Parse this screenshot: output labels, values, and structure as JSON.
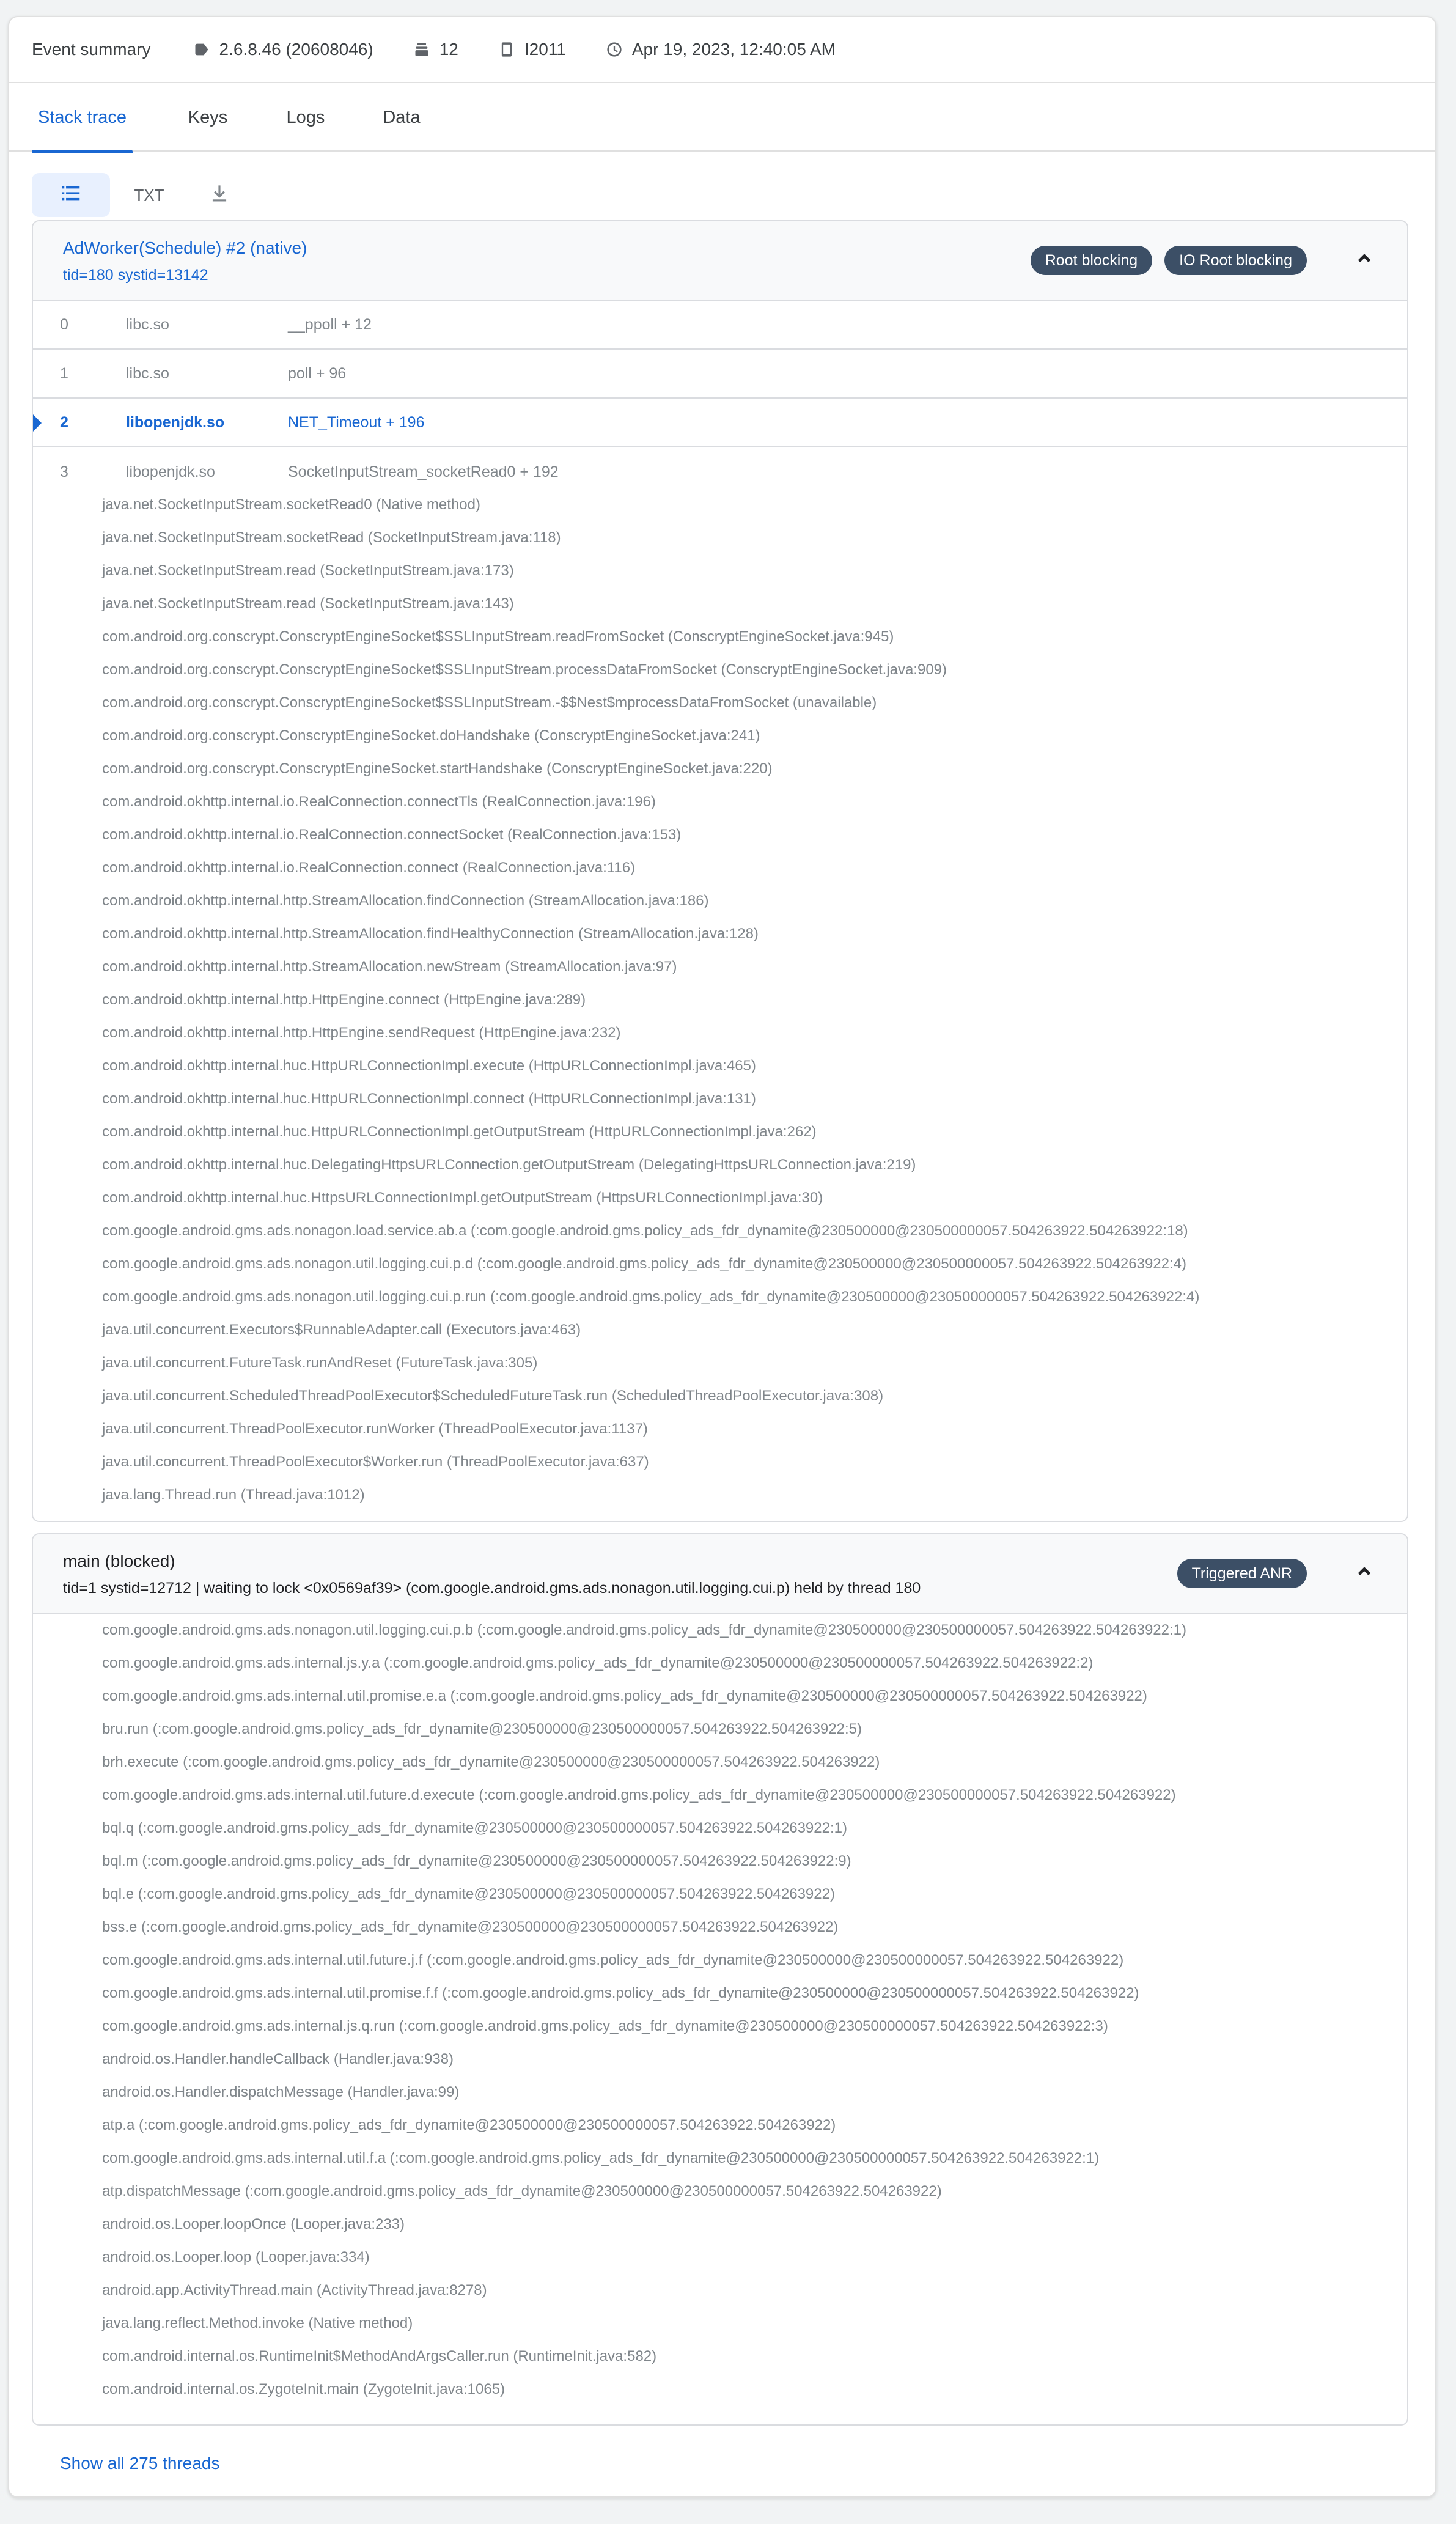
{
  "summary": {
    "label": "Event summary",
    "version": "2.6.8.46 (20608046)",
    "version_icon": "tag-icon",
    "devices": "12",
    "devices_icon": "stack-icon",
    "device_model": "I2011",
    "device_icon": "phone-icon",
    "timestamp": "Apr 19, 2023, 12:40:05 AM",
    "time_icon": "clock-icon"
  },
  "tabs": [
    "Stack trace",
    "Keys",
    "Logs",
    "Data"
  ],
  "active_tab": "Stack trace",
  "toolbar": {
    "list_icon": "list-icon",
    "txt_label": "TXT",
    "download_icon": "download-icon"
  },
  "colors": {
    "accent": "#1967d2",
    "badge_bg": "#3c4f66",
    "selected_bg": "#e8f0fe",
    "muted_text": "#80868b"
  },
  "thread1": {
    "name": "AdWorker(Schedule) #2 (native)",
    "sub": "tid=180 systid=13142",
    "badges": [
      "Root blocking",
      "IO Root blocking"
    ],
    "frames": [
      {
        "idx": "0",
        "lib": "libc.so",
        "sym": "__ppoll + 12"
      },
      {
        "idx": "1",
        "lib": "libc.so",
        "sym": "poll + 96"
      },
      {
        "idx": "2",
        "lib": "libopenjdk.so",
        "sym": "NET_Timeout + 196"
      },
      {
        "idx": "3",
        "lib": "libopenjdk.so",
        "sym": "SocketInputStream_socketRead0 + 192"
      }
    ],
    "java": [
      "java.net.SocketInputStream.socketRead0 (Native method)",
      "java.net.SocketInputStream.socketRead (SocketInputStream.java:118)",
      "java.net.SocketInputStream.read (SocketInputStream.java:173)",
      "java.net.SocketInputStream.read (SocketInputStream.java:143)",
      "com.android.org.conscrypt.ConscryptEngineSocket$SSLInputStream.readFromSocket (ConscryptEngineSocket.java:945)",
      "com.android.org.conscrypt.ConscryptEngineSocket$SSLInputStream.processDataFromSocket (ConscryptEngineSocket.java:909)",
      "com.android.org.conscrypt.ConscryptEngineSocket$SSLInputStream.-$$Nest$mprocessDataFromSocket (unavailable)",
      "com.android.org.conscrypt.ConscryptEngineSocket.doHandshake (ConscryptEngineSocket.java:241)",
      "com.android.org.conscrypt.ConscryptEngineSocket.startHandshake (ConscryptEngineSocket.java:220)",
      "com.android.okhttp.internal.io.RealConnection.connectTls (RealConnection.java:196)",
      "com.android.okhttp.internal.io.RealConnection.connectSocket (RealConnection.java:153)",
      "com.android.okhttp.internal.io.RealConnection.connect (RealConnection.java:116)",
      "com.android.okhttp.internal.http.StreamAllocation.findConnection (StreamAllocation.java:186)",
      "com.android.okhttp.internal.http.StreamAllocation.findHealthyConnection (StreamAllocation.java:128)",
      "com.android.okhttp.internal.http.StreamAllocation.newStream (StreamAllocation.java:97)",
      "com.android.okhttp.internal.http.HttpEngine.connect (HttpEngine.java:289)",
      "com.android.okhttp.internal.http.HttpEngine.sendRequest (HttpEngine.java:232)",
      "com.android.okhttp.internal.huc.HttpURLConnectionImpl.execute (HttpURLConnectionImpl.java:465)",
      "com.android.okhttp.internal.huc.HttpURLConnectionImpl.connect (HttpURLConnectionImpl.java:131)",
      "com.android.okhttp.internal.huc.HttpURLConnectionImpl.getOutputStream (HttpURLConnectionImpl.java:262)",
      "com.android.okhttp.internal.huc.DelegatingHttpsURLConnection.getOutputStream (DelegatingHttpsURLConnection.java:219)",
      "com.android.okhttp.internal.huc.HttpsURLConnectionImpl.getOutputStream (HttpsURLConnectionImpl.java:30)",
      "com.google.android.gms.ads.nonagon.load.service.ab.a (:com.google.android.gms.policy_ads_fdr_dynamite@230500000@230500000057.504263922.504263922:18)",
      "com.google.android.gms.ads.nonagon.util.logging.cui.p.d (:com.google.android.gms.policy_ads_fdr_dynamite@230500000@230500000057.504263922.504263922:4)",
      "com.google.android.gms.ads.nonagon.util.logging.cui.p.run (:com.google.android.gms.policy_ads_fdr_dynamite@230500000@230500000057.504263922.504263922:4)",
      "java.util.concurrent.Executors$RunnableAdapter.call (Executors.java:463)",
      "java.util.concurrent.FutureTask.runAndReset (FutureTask.java:305)",
      "java.util.concurrent.ScheduledThreadPoolExecutor$ScheduledFutureTask.run (ScheduledThreadPoolExecutor.java:308)",
      "java.util.concurrent.ThreadPoolExecutor.runWorker (ThreadPoolExecutor.java:1137)",
      "java.util.concurrent.ThreadPoolExecutor$Worker.run (ThreadPoolExecutor.java:637)",
      "java.lang.Thread.run (Thread.java:1012)"
    ]
  },
  "thread2": {
    "name": "main (blocked)",
    "sub": "tid=1 systid=12712 | waiting to lock <0x0569af39> (com.google.android.gms.ads.nonagon.util.logging.cui.p) held by thread 180",
    "badges": [
      "Triggered ANR"
    ],
    "java": [
      "com.google.android.gms.ads.nonagon.util.logging.cui.p.b (:com.google.android.gms.policy_ads_fdr_dynamite@230500000@230500000057.504263922.504263922:1)",
      "com.google.android.gms.ads.internal.js.y.a (:com.google.android.gms.policy_ads_fdr_dynamite@230500000@230500000057.504263922.504263922:2)",
      "com.google.android.gms.ads.internal.util.promise.e.a (:com.google.android.gms.policy_ads_fdr_dynamite@230500000@230500000057.504263922.504263922)",
      "bru.run (:com.google.android.gms.policy_ads_fdr_dynamite@230500000@230500000057.504263922.504263922:5)",
      "brh.execute (:com.google.android.gms.policy_ads_fdr_dynamite@230500000@230500000057.504263922.504263922)",
      "com.google.android.gms.ads.internal.util.future.d.execute (:com.google.android.gms.policy_ads_fdr_dynamite@230500000@230500000057.504263922.504263922)",
      "bql.q (:com.google.android.gms.policy_ads_fdr_dynamite@230500000@230500000057.504263922.504263922:1)",
      "bql.m (:com.google.android.gms.policy_ads_fdr_dynamite@230500000@230500000057.504263922.504263922:9)",
      "bql.e (:com.google.android.gms.policy_ads_fdr_dynamite@230500000@230500000057.504263922.504263922)",
      "bss.e (:com.google.android.gms.policy_ads_fdr_dynamite@230500000@230500000057.504263922.504263922)",
      "com.google.android.gms.ads.internal.util.future.j.f (:com.google.android.gms.policy_ads_fdr_dynamite@230500000@230500000057.504263922.504263922)",
      "com.google.android.gms.ads.internal.util.promise.f.f (:com.google.android.gms.policy_ads_fdr_dynamite@230500000@230500000057.504263922.504263922)",
      "com.google.android.gms.ads.internal.js.q.run (:com.google.android.gms.policy_ads_fdr_dynamite@230500000@230500000057.504263922.504263922:3)",
      "android.os.Handler.handleCallback (Handler.java:938)",
      "android.os.Handler.dispatchMessage (Handler.java:99)",
      "atp.a (:com.google.android.gms.policy_ads_fdr_dynamite@230500000@230500000057.504263922.504263922)",
      "com.google.android.gms.ads.internal.util.f.a (:com.google.android.gms.policy_ads_fdr_dynamite@230500000@230500000057.504263922.504263922:1)",
      "atp.dispatchMessage (:com.google.android.gms.policy_ads_fdr_dynamite@230500000@230500000057.504263922.504263922)",
      "android.os.Looper.loopOnce (Looper.java:233)",
      "android.os.Looper.loop (Looper.java:334)",
      "android.app.ActivityThread.main (ActivityThread.java:8278)",
      "java.lang.reflect.Method.invoke (Native method)",
      "com.android.internal.os.RuntimeInit$MethodAndArgsCaller.run (RuntimeInit.java:582)",
      "com.android.internal.os.ZygoteInit.main (ZygoteInit.java:1065)"
    ]
  },
  "show_all": "Show all 275 threads"
}
